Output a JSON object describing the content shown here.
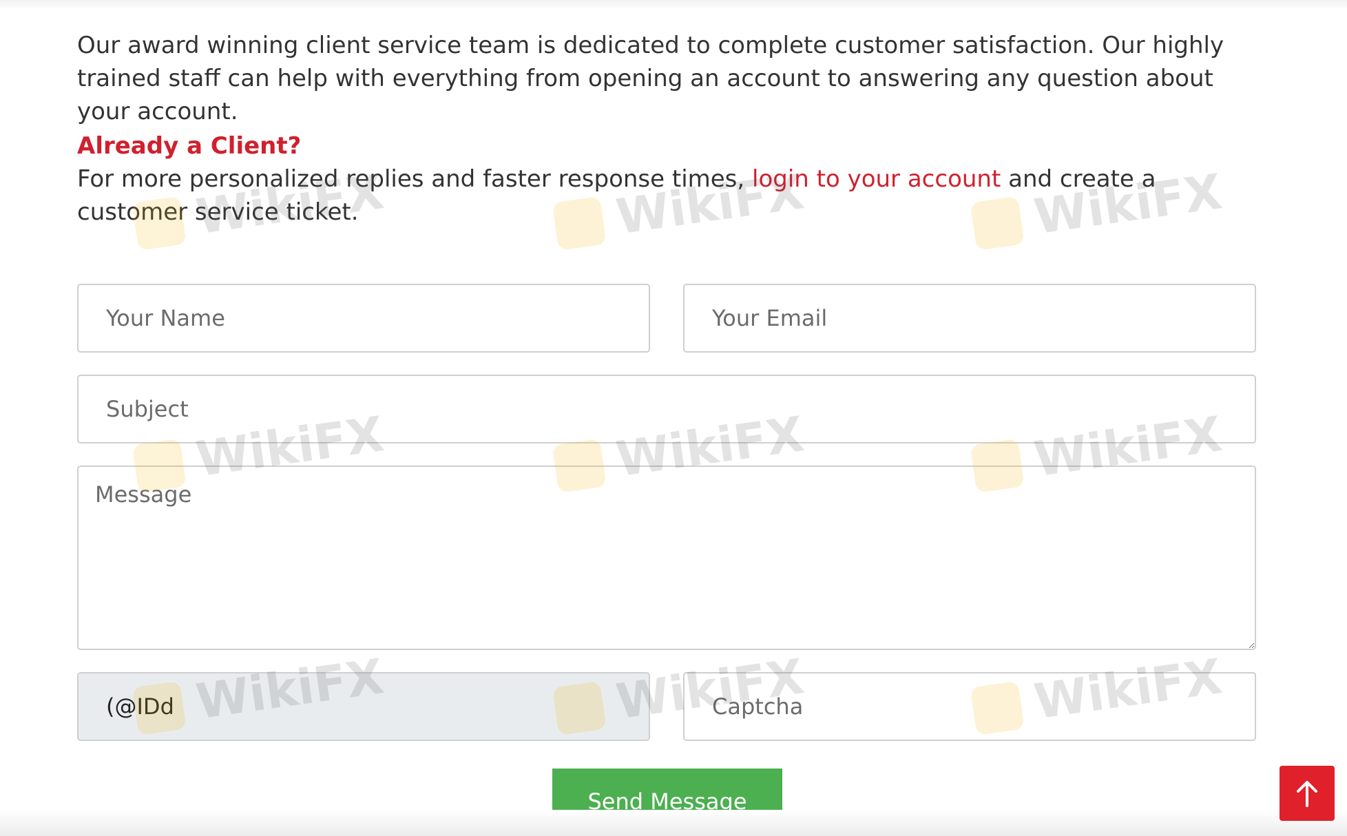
{
  "intro": {
    "text": "Our award winning client service team is dedicated to complete customer satisfaction. Our highly trained staff can help with everything from opening an account to answering any question about your account."
  },
  "client": {
    "heading": "Already a Client?",
    "text_before": "For more personalized replies and faster response times, ",
    "link_label": "login to your account",
    "text_after": " and create a customer service ticket."
  },
  "form": {
    "name_placeholder": "Your Name",
    "email_placeholder": "Your Email",
    "subject_placeholder": "Subject",
    "message_placeholder": "Message",
    "captcha_code": "(@IDd",
    "captcha_placeholder": "Captcha",
    "send_label": "Send Message"
  },
  "watermark": {
    "text": "WikiFX"
  },
  "colors": {
    "accent_red": "#d0202e",
    "button_green": "#4caf50",
    "scroll_top_red": "#e0202a"
  },
  "icons": {
    "scroll_top": "arrow-up-icon"
  }
}
